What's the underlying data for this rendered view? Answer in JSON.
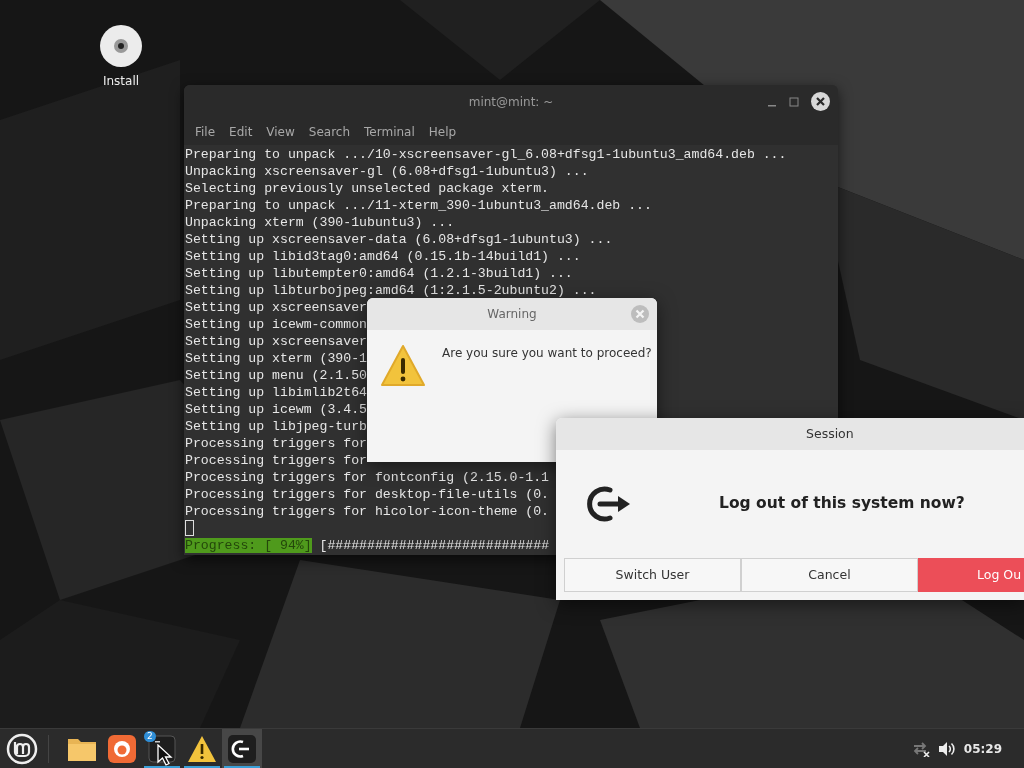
{
  "desktop": {
    "icons": [
      {
        "label": "Install"
      }
    ]
  },
  "terminal": {
    "title": "mint@mint: ~",
    "menu": [
      "File",
      "Edit",
      "View",
      "Search",
      "Terminal",
      "Help"
    ],
    "lines": [
      "Preparing to unpack .../10-xscreensaver-gl_6.08+dfsg1-1ubuntu3_amd64.deb ...",
      "Unpacking xscreensaver-gl (6.08+dfsg1-1ubuntu3) ...",
      "Selecting previously unselected package xterm.",
      "Preparing to unpack .../11-xterm_390-1ubuntu3_amd64.deb ...",
      "Unpacking xterm (390-1ubuntu3) ...",
      "Setting up xscreensaver-data (6.08+dfsg1-1ubuntu3) ...",
      "Setting up libid3tag0:amd64 (0.15.1b-14build1) ...",
      "Setting up libutempter0:amd64 (1.2.1-3build1) ...",
      "Setting up libturbojpeg:amd64 (1:2.1.5-2ubuntu2) ...",
      "Setting up xscreensaver",
      "Setting up icewm-common",
      "Setting up xscreensaver",
      "Setting up xterm (390-1",
      "Setting up menu (2.1.50",
      "Setting up libimlib2t64",
      "Setting up icewm (3.4.5",
      "Setting up libjpeg-turb",
      "Processing triggers for",
      "Processing triggers for",
      "Processing triggers for fontconfig (2.15.0-1.1",
      "Processing triggers for desktop-file-utils (0.",
      "Processing triggers for hicolor-icon-theme (0."
    ],
    "cursor": true,
    "progress": {
      "label": "Progress: [ 94%]",
      "bar": "[############################"
    }
  },
  "warning_dialog": {
    "title": "Warning",
    "message": "Are you sure you want to proceed?"
  },
  "session_dialog": {
    "title": "Session",
    "message": "Log out of this system now?",
    "buttons": [
      {
        "label": "Switch User",
        "kind": "normal"
      },
      {
        "label": "Cancel",
        "kind": "normal"
      },
      {
        "label": "Log Ou",
        "kind": "destructive"
      }
    ]
  },
  "taskbar": {
    "apps": [
      {
        "kind": "files",
        "active": false,
        "selected": false
      },
      {
        "kind": "browser",
        "active": false,
        "selected": false
      },
      {
        "kind": "terminal",
        "active": true,
        "selected": false,
        "badge": "2"
      },
      {
        "kind": "warning",
        "active": true,
        "selected": false
      },
      {
        "kind": "session",
        "active": true,
        "selected": true
      }
    ],
    "clock": "05:29"
  }
}
